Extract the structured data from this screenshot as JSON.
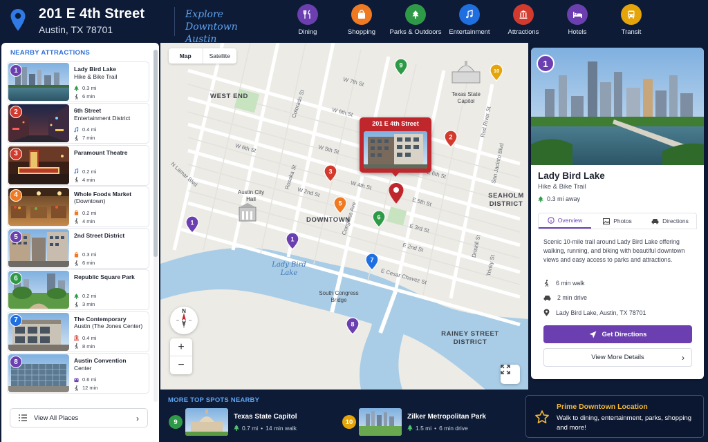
{
  "header": {
    "address_line1": "201 E 4th Street",
    "address_line2": "Austin, TX 78701",
    "tagline": "Explore Downtown Austin",
    "categories": [
      {
        "label": "Dining",
        "color": "#6b3fb0",
        "icon": "utensils-icon"
      },
      {
        "label": "Shopping",
        "color": "#f07a22",
        "icon": "shopping-bag-icon"
      },
      {
        "label": "Parks & Outdoors",
        "color": "#2e9a47",
        "icon": "tree-icon"
      },
      {
        "label": "Entertainment",
        "color": "#1f6fe0",
        "icon": "music-note-icon"
      },
      {
        "label": "Attractions",
        "color": "#d23a2e",
        "icon": "landmark-icon"
      },
      {
        "label": "Hotels",
        "color": "#6b3fb0",
        "icon": "bed-icon"
      },
      {
        "label": "Transit",
        "color": "#e5a50a",
        "icon": "bus-icon"
      }
    ]
  },
  "nearby": {
    "title": "NEARBY ATTRACTIONS",
    "items": [
      {
        "num": "1",
        "color": "#6b3fb0",
        "name": "Lady Bird Lake",
        "sub": "Hike & Bike Trail",
        "icon": "tree-icon",
        "dist": "0.3 mi",
        "time": "6 min"
      },
      {
        "num": "2",
        "color": "#d23a2e",
        "name": "6th Street",
        "sub": "Entertainment District",
        "icon": "music-note-icon",
        "dist": "0.4 mi",
        "time": "7 min"
      },
      {
        "num": "3",
        "color": "#d23a2e",
        "name": "Paramount Theatre",
        "sub": "",
        "icon": "music-note-icon",
        "dist": "0.2 mi",
        "time": "4 min"
      },
      {
        "num": "4",
        "color": "#f07a22",
        "name": "Whole Foods Market",
        "sub": "(Downtown)",
        "icon": "shopping-bag-icon",
        "dist": "0.2 mi",
        "time": "4 min"
      },
      {
        "num": "5",
        "color": "#6b3fb0",
        "name": "2nd Street District",
        "sub": "",
        "icon": "shopping-bag-icon",
        "dist": "0.3 mi",
        "time": "6 min"
      },
      {
        "num": "6",
        "color": "#2e9a47",
        "name": "Republic Square Park",
        "sub": "",
        "icon": "tree-icon",
        "dist": "0.2 mi",
        "time": "3 min"
      },
      {
        "num": "7",
        "color": "#1f6fe0",
        "name": "The Contemporary",
        "sub": "Austin (The Jones Center)",
        "icon": "landmark-icon",
        "dist": "0.4 mi",
        "time": "8 min"
      },
      {
        "num": "8",
        "color": "#6b3fb0",
        "name": "Austin Convention",
        "sub": "Center",
        "icon": "building-icon",
        "dist": "0.6 mi",
        "time": "12 min"
      }
    ],
    "view_all": "View All Places"
  },
  "map": {
    "mode_map": "Map",
    "mode_satellite": "Satellite",
    "callout": "201 E 4th Street",
    "districts": [
      "WEST END",
      "DOWNTOWN",
      "SEAHOLM DISTRICT",
      "RAINEY STREET DISTRICT"
    ],
    "lake": "Lady Bird Lake",
    "places": [
      "Texas State Capitol",
      "Austin City Hall",
      "South Congress Bridge"
    ],
    "streets": [
      "W 7th St",
      "W 6th St",
      "W 5th St",
      "W 4th St",
      "W 2nd St",
      "E 6th St",
      "E 5th St",
      "E 3rd St",
      "E 2nd St",
      "E Cesar Chavez St",
      "E 5th St",
      "Congress Ave",
      "Colorado St",
      "Rosewood St",
      "Lavaca St",
      "N Lamar Blvd",
      "Red River St",
      "Trinity St",
      "Driskill St",
      "San Jacinto Blvd",
      "Rosaka St"
    ],
    "compass": "N",
    "zoom_in": "+",
    "zoom_out": "−"
  },
  "bottom": {
    "title": "MORE TOP SPOTS NEARBY",
    "spots": [
      {
        "num": "9",
        "color": "#2e9a47",
        "name": "Texas State Capitol",
        "dist": "0.7 mi",
        "time": "14 min walk"
      },
      {
        "num": "10",
        "color": "#e5a50a",
        "name": "Zilker Metropolitan Park",
        "dist": "1.5 mi",
        "time": "6 min drive"
      }
    ],
    "prime_title": "Prime Downtown Location",
    "prime_desc": "Walk to dining, entertainment, parks, shopping and more!"
  },
  "detail": {
    "num": "1",
    "name": "Lady Bird Lake",
    "type": "Hike & Bike Trail",
    "distance": "0.3 mi away",
    "tabs": [
      "Overview",
      "Photos",
      "Directions"
    ],
    "description": "Scenic 10-mile trail around Lady Bird Lake offering walking, running, and biking with beautiful downtown views and easy access to parks and attractions.",
    "walk": "6 min walk",
    "drive": "2 min drive",
    "location": "Lady Bird Lake, Austin, TX 78701",
    "primary_button": "Get Directions",
    "secondary_button": "View More Details"
  }
}
